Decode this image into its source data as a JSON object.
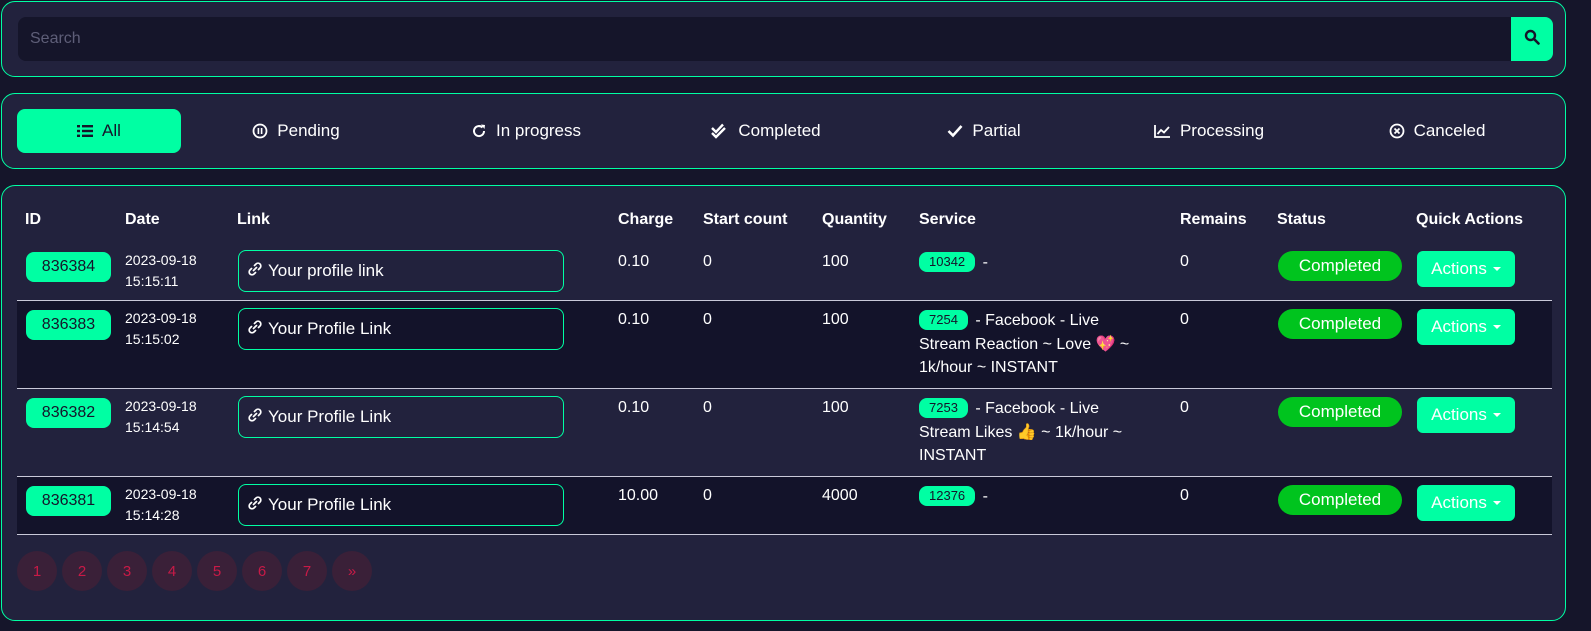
{
  "search": {
    "placeholder": "Search",
    "button_icon": "search-icon"
  },
  "filters": [
    {
      "label": "All",
      "icon": "list-icon",
      "active": true
    },
    {
      "label": "Pending",
      "icon": "pause-circle-icon"
    },
    {
      "label": "In progress",
      "icon": "refresh-icon"
    },
    {
      "label": "Completed",
      "icon": "double-check-icon"
    },
    {
      "label": "Partial",
      "icon": "check-icon"
    },
    {
      "label": "Processing",
      "icon": "chart-line-icon"
    },
    {
      "label": "Canceled",
      "icon": "x-circle-icon"
    }
  ],
  "table": {
    "headers": {
      "id": "ID",
      "date": "Date",
      "link": "Link",
      "charge": "Charge",
      "start_count": "Start count",
      "quantity": "Quantity",
      "service": "Service",
      "remains": "Remains",
      "status": "Status",
      "quick_actions": "Quick Actions"
    },
    "rows": [
      {
        "id": "836384",
        "date_day": "2023-09-18",
        "date_time": "15:15:11",
        "link": "Your profile link",
        "charge": "0.10",
        "start_count": "0",
        "quantity": "100",
        "service_id": "10342",
        "service_name": " -",
        "remains": "0",
        "status": "Completed",
        "action": "Actions"
      },
      {
        "id": "836383",
        "date_day": "2023-09-18",
        "date_time": "15:15:02",
        "link": "Your Profile Link",
        "charge": "0.10",
        "start_count": "0",
        "quantity": "100",
        "service_id": "7254",
        "service_name": " - Facebook - Live Stream Reaction ~ Love 💖 ~ 1k/hour ~ INSTANT",
        "remains": "0",
        "status": "Completed",
        "action": "Actions"
      },
      {
        "id": "836382",
        "date_day": "2023-09-18",
        "date_time": "15:14:54",
        "link": "Your Profile Link",
        "charge": "0.10",
        "start_count": "0",
        "quantity": "100",
        "service_id": "7253",
        "service_name": " - Facebook - Live Stream Likes 👍 ~ 1k/hour ~ INSTANT",
        "remains": "0",
        "status": "Completed",
        "action": "Actions"
      },
      {
        "id": "836381",
        "date_day": "2023-09-18",
        "date_time": "15:14:28",
        "link": "Your Profile Link",
        "charge": "10.00",
        "start_count": "0",
        "quantity": "4000",
        "service_id": "12376",
        "service_name": " -",
        "remains": "0",
        "status": "Completed",
        "action": "Actions"
      }
    ]
  },
  "pagination": [
    "1",
    "2",
    "3",
    "4",
    "5",
    "6",
    "7",
    "»"
  ],
  "colors": {
    "accent": "#00ffa3",
    "status_completed": "#00c41e",
    "background": "#15152a",
    "panel": "#22223d",
    "pager_text": "#c81a47"
  }
}
